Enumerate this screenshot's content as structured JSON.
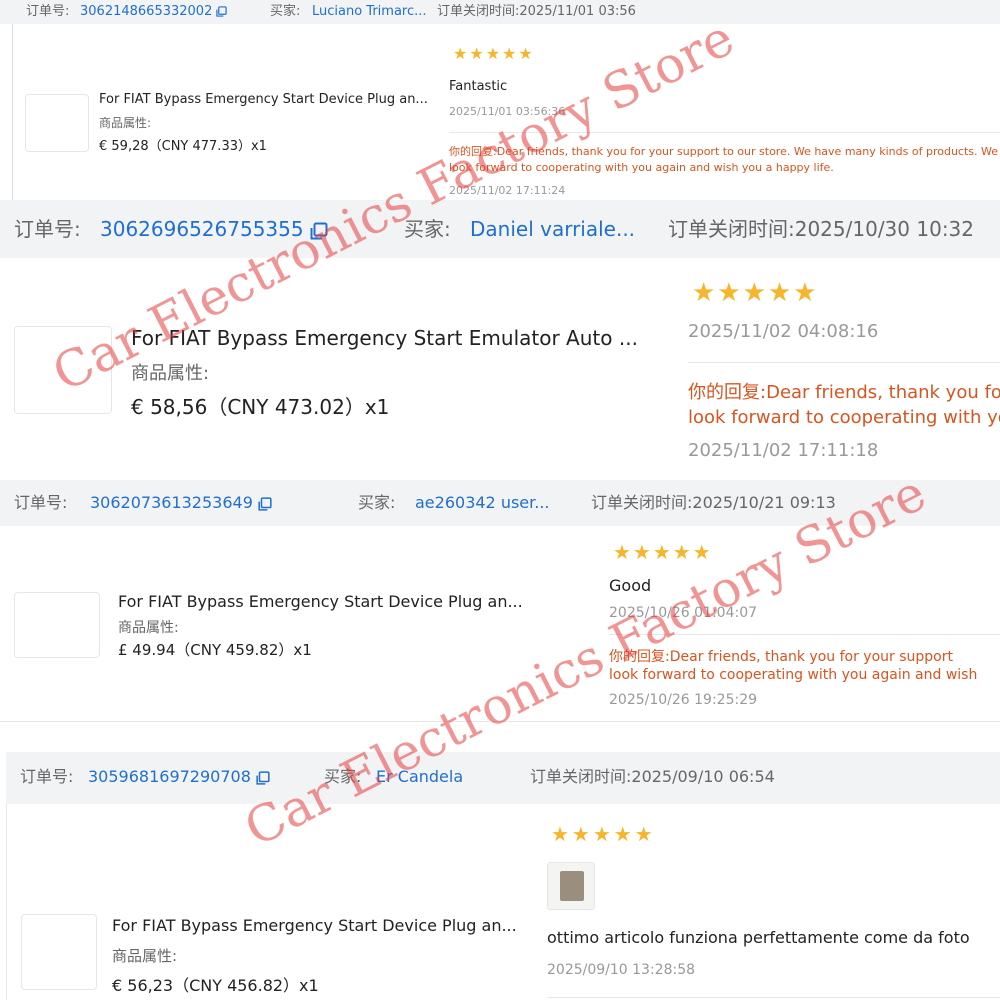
{
  "orders": [
    {
      "order_label": "订单号:",
      "order_id": "3062148665332002",
      "buyer_label": "买家:",
      "buyer": "Luciano Trimarc...",
      "close_time": "订单关闭时间:2025/11/01 03:56",
      "product_title": "For FIAT Bypass Emergency Start Device Plug an...",
      "attr_label": "商品属性:",
      "price": "€ 59,28（CNY  477.33）x1",
      "stars": "★★★★★",
      "review_text": "Fantastic",
      "review_date": "2025/11/01 03:56:36",
      "reply_label": "你的回复:",
      "reply_text": "Dear friends, thank you for your support to our store. We have many kinds of products. We look forward to cooperating with you again and wish you a happy life.",
      "reply_date": "2025/11/02 17:11:24"
    },
    {
      "order_label": "订单号:",
      "order_id": "3062696526755355",
      "buyer_label": "买家:",
      "buyer": "Daniel varriale...",
      "close_time": "订单关闭时间:2025/10/30 10:32",
      "product_title": "For FIAT Bypass Emergency Start Emulator Auto ...",
      "attr_label": "商品属性:",
      "price": "€ 58,56（CNY  473.02）x1",
      "stars": "★★★★★",
      "review_date": "2025/11/02 04:08:16",
      "reply_label": "你的回复:",
      "reply_line1": "Dear friends, thank you fo",
      "reply_line2": "look forward to cooperating with you",
      "reply_date": "2025/11/02 17:11:18"
    },
    {
      "order_label": "订单号:",
      "order_id": "3062073613253649",
      "buyer_label": "买家:",
      "buyer": "ae260342 user...",
      "close_time": "订单关闭时间:2025/10/21 09:13",
      "product_title": "For FIAT Bypass Emergency Start Device Plug an...",
      "attr_label": "商品属性:",
      "price": "£ 49.94（CNY  459.82）x1",
      "stars": "★★★★★",
      "review_text": "Good",
      "review_date": "2025/10/26 01:04:07",
      "reply_label": "你的回复:",
      "reply_line1": "Dear friends, thank you for your support",
      "reply_line2": "look forward to cooperating with you again and wish",
      "reply_date": "2025/10/26 19:25:29"
    },
    {
      "order_label": "订单号:",
      "order_id": "3059681697290708",
      "buyer_label": "买家:",
      "buyer": "Er Candela",
      "close_time": "订单关闭时间:2025/09/10 06:54",
      "product_title": "For FIAT Bypass Emergency Start Device Plug an...",
      "attr_label": "商品属性:",
      "price": "€ 56,23（CNY  456.82）x1",
      "stars": "★★★★★",
      "review_text": "ottimo articolo funziona perfettamente come da foto",
      "review_date": "2025/09/10 13:28:58"
    }
  ],
  "watermark": "Car Electronics Factory Store",
  "colors": {
    "link": "#1f6fd1",
    "star": "#f7b52c",
    "reply": "#d9541e",
    "watermark": "#e63c3c"
  }
}
